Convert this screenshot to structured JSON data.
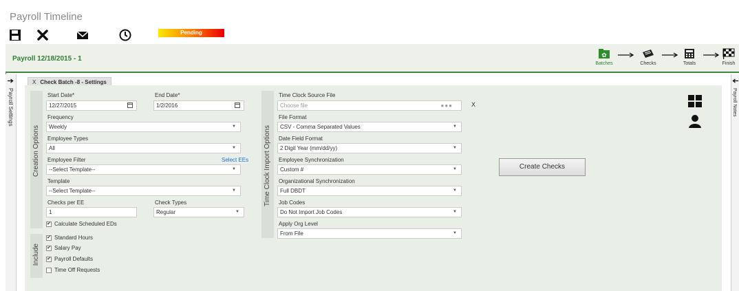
{
  "app": {
    "title": "Payroll Timeline"
  },
  "toolbar": {
    "status": "Pending",
    "icons": [
      "save-icon",
      "close-icon",
      "mail-icon",
      "clock-icon"
    ]
  },
  "payroll": {
    "title": "Payroll 12/18/2015 - 1",
    "steps": [
      {
        "label": "Batches",
        "icon": "batches-icon",
        "active": true
      },
      {
        "label": "Checks",
        "icon": "checks-icon",
        "active": false
      },
      {
        "label": "Totals",
        "icon": "calculator-icon",
        "active": false
      },
      {
        "label": "Finish",
        "icon": "finish-flag-icon",
        "active": false
      }
    ]
  },
  "rails": {
    "left": "Payroll Settings",
    "right": "Payroll Notes"
  },
  "tab": {
    "close": "X",
    "title": "Check Batch -8 - Settings"
  },
  "creation": {
    "section_label": "Creation Options",
    "start_date_label": "Start Date*",
    "start_date": "12/27/2015",
    "end_date_label": "End Date*",
    "end_date": "1/2/2016",
    "frequency_label": "Frequency",
    "frequency": "Weekly",
    "employee_types_label": "Employee Types",
    "employee_types": "All",
    "employee_filter_label": "Employee Filter",
    "select_ees": "Select EEs",
    "employee_filter": "--Select Template--",
    "template_label": "Template",
    "template": "--Select Template--",
    "checks_per_ee_label": "Checks per EE",
    "checks_per_ee": "1",
    "check_types_label": "Check Types",
    "check_types": "Regular",
    "calc_scheduled": "Calculate Scheduled EDs"
  },
  "include": {
    "section_label": "Include",
    "items": [
      {
        "label": "Standard Hours",
        "checked": true
      },
      {
        "label": "Salary Pay",
        "checked": true
      },
      {
        "label": "Payroll Defaults",
        "checked": true
      },
      {
        "label": "Time Off Requests",
        "checked": false
      }
    ]
  },
  "timeclock": {
    "section_label": "Time Clock Import Options",
    "source_file_label": "Time Clock Source File",
    "source_file_placeholder": "Choose file",
    "clear": "X",
    "file_format_label": "File Format",
    "file_format": "CSV - Comma Separated Values",
    "date_field_format_label": "Date Field Format",
    "date_field_format": "2 Digit Year (mm/dd/yy)",
    "employee_sync_label": "Employee Synchronization",
    "employee_sync": "Custom #",
    "org_sync_label": "Organizational Synchronization",
    "org_sync": "Full DBDT",
    "job_codes_label": "Job Codes",
    "job_codes": "Do Not Import Job Codes",
    "apply_org_level_label": "Apply Org Level",
    "apply_org_level": "From File"
  },
  "actions": {
    "create_checks": "Create Checks"
  }
}
